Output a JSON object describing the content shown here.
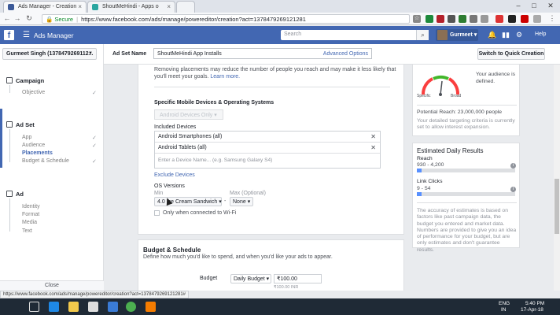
{
  "browser": {
    "tabs": [
      {
        "title": "Ads Manager - Creation",
        "active": true
      },
      {
        "title": "ShoutMeHindi - Apps o",
        "active": false
      }
    ],
    "url_secure_label": "Secure",
    "url": "https://www.facebook.com/ads/manage/powereditor/creation?act=1378479269121281",
    "status_url": "https://www.facebook.com/ads/manage/powereditor/creation?act=1378479269121281#"
  },
  "header": {
    "logo": "f",
    "app_name": "Ads Manager",
    "search_placeholder": "Search",
    "user_name": "Gurmeet",
    "help_label": "Help"
  },
  "left_nav": {
    "account": "Gurmeet Singh (1378479269112...",
    "campaign": {
      "title": "Campaign",
      "items": [
        "Objective"
      ]
    },
    "ad_set": {
      "title": "Ad Set",
      "items": [
        "App",
        "Audience",
        "Placements",
        "Budget & Schedule"
      ],
      "active_item": "Placements"
    },
    "ad": {
      "title": "Ad",
      "items": [
        "Identity",
        "Format",
        "Media",
        "Text"
      ]
    },
    "close_label": "Close"
  },
  "top_strip": {
    "ad_set_label": "Ad Set Name",
    "ad_set_name": "ShoutMeHindi App Installs",
    "advanced_options": "Advanced Options",
    "switch_button": "Switch to Quick Creation"
  },
  "placements": {
    "note_prefix": "Removing placements may reduce the number of people you reach and may make it less likely that you'll meet your goals.",
    "learn_more": "Learn more.",
    "section_title": "Specific Mobile Devices & Operating Systems",
    "devices_dropdown": "Android Devices Only",
    "included_devices_label": "Included Devices",
    "included_devices": [
      "Android Smartphones (all)",
      "Android Tablets (all)"
    ],
    "device_input_placeholder": "Enter a Device Name... (e.g. Samsung Galaxy S4)",
    "exclude_devices": "Exclude Devices",
    "os_versions_label": "OS Versions",
    "min_label": "Min",
    "max_label": "Max (Optional)",
    "min_value": "4.0 Ice Cream Sandwich",
    "max_value": "None",
    "dash": "-",
    "wifi_label": "Only when connected to Wi-Fi"
  },
  "budget": {
    "title": "Budget & Schedule",
    "subtitle": "Define how much you'd like to spend, and when you'd like your ads to appear.",
    "budget_label": "Budget",
    "budget_type": "Daily Budget",
    "budget_value": "₹100.00",
    "budget_currency_note": "₹100.00 INR"
  },
  "audience_panel": {
    "specific_label": "Specific",
    "broad_label": "Broad",
    "defined_text": "Your audience is defined.",
    "potential_reach": "Potential Reach: 23,000,000 people",
    "criteria_text": "Your detailed targeting criteria is currently set to allow interest expansion."
  },
  "results_panel": {
    "title": "Estimated Daily Results",
    "reach_label": "Reach",
    "reach_value": "930 - 4,200",
    "reach_level": 0.05,
    "clicks_label": "Link Clicks",
    "clicks_value": "9 - 54",
    "clicks_level": 0.05,
    "disclaimer": "The accuracy of estimates is based on factors like past campaign data, the budget you entered and market data. Numbers are provided to give you an idea of performance for your budget, but are only estimates and don't guarantee results."
  },
  "taskbar": {
    "lang1": "ENG",
    "lang2": "IN",
    "time": "5:40 PM",
    "date": "17-Apr-18"
  },
  "colors": {
    "fb_blue": "#4267b2",
    "bar_fill": "#5890ff"
  }
}
